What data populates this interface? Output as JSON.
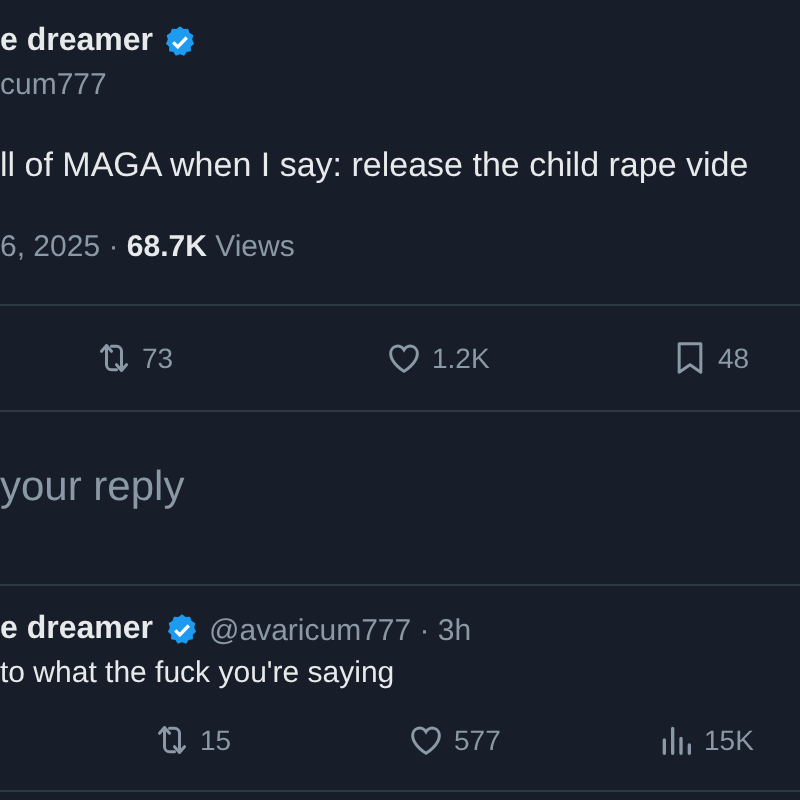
{
  "post": {
    "author_name": "e dreamer",
    "verified": true,
    "handle": "cum777",
    "text": "ll of MAGA when I say: release the child rape vide",
    "meta": "6, 2025 · **68.7K** Views",
    "stats": [
      {
        "kind": "retweet",
        "count": "73"
      },
      {
        "kind": "like",
        "count": "1.2K"
      },
      {
        "kind": "bookmark",
        "count": "48"
      }
    ]
  },
  "reply_box": {
    "placeholder": "your reply"
  },
  "reply": {
    "author_name": "e dreamer",
    "verified": true,
    "handle_time": "@avaricum777 · 3h",
    "text": "to what the fuck you're saying",
    "stats": [
      {
        "kind": "retweet",
        "count": "15"
      },
      {
        "kind": "like",
        "count": "577"
      },
      {
        "kind": "views",
        "count": "15K"
      }
    ]
  }
}
